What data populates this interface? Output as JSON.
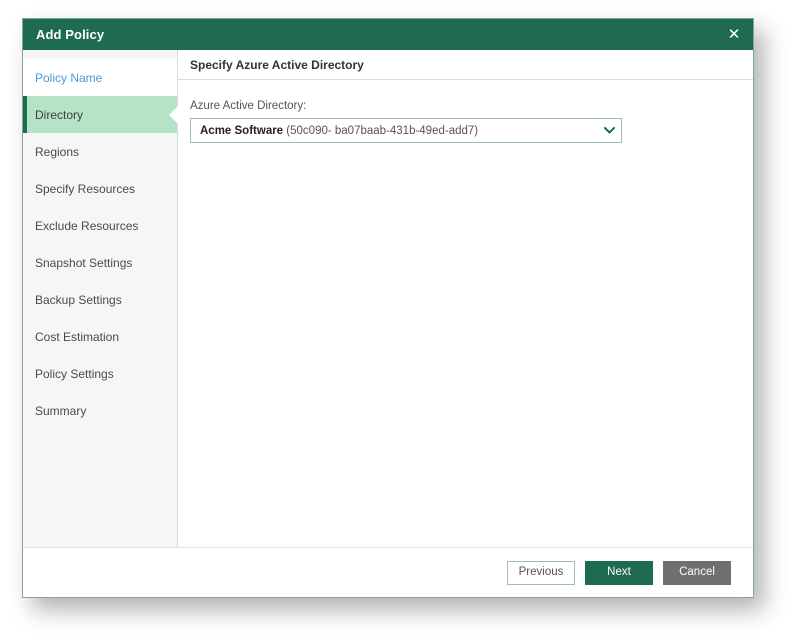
{
  "window": {
    "title": "Add Policy",
    "close_icon": "close-icon",
    "close_glyph": "✕",
    "accent_color": "#1f6b4f",
    "selected_nav_color": "#b6e2c6",
    "link_color": "#4a9ad4"
  },
  "sidebar": {
    "items": [
      {
        "label": "Policy Name",
        "state": "link"
      },
      {
        "label": "Directory",
        "state": "active"
      },
      {
        "label": "Regions",
        "state": "plain"
      },
      {
        "label": "Specify Resources",
        "state": "plain"
      },
      {
        "label": "Exclude Resources",
        "state": "plain"
      },
      {
        "label": "Snapshot Settings",
        "state": "plain"
      },
      {
        "label": "Backup Settings",
        "state": "plain"
      },
      {
        "label": "Cost Estimation",
        "state": "plain"
      },
      {
        "label": "Policy Settings",
        "state": "plain"
      },
      {
        "label": "Summary",
        "state": "plain"
      }
    ]
  },
  "content": {
    "header": "Specify Azure Active Directory",
    "field": {
      "label": "Azure Active Directory:",
      "value_name": "Acme Software",
      "value_id": "(50c090- ba07baab-431b-49ed-add7)",
      "chevron_icon": "chevron-down-icon"
    }
  },
  "footer": {
    "previous_label": "Previous",
    "next_label": "Next",
    "cancel_label": "Cancel"
  }
}
